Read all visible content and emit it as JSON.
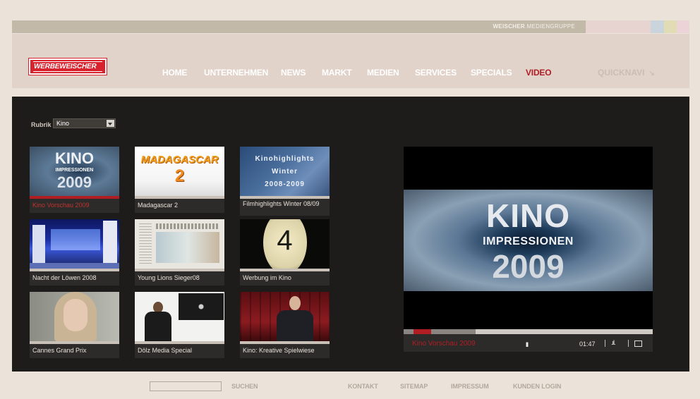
{
  "topbar": {
    "brand_bold": "WEISCHER",
    "brand_rest": ".MEDIENGRUPPE",
    "swatches": [
      "#e7d4d0",
      "#c9d4dc",
      "#e1dcb4",
      "#ecd3d8"
    ]
  },
  "header": {
    "logo_text": "WERBEWEISCHER",
    "nav": [
      {
        "label": "HOME",
        "active": false
      },
      {
        "label": "UNTERNEHMEN",
        "active": false
      },
      {
        "label": "NEWS",
        "active": false
      },
      {
        "label": "MARKT",
        "active": false
      },
      {
        "label": "MEDIEN",
        "active": false
      },
      {
        "label": "SERVICES",
        "active": false
      },
      {
        "label": "SPECIALS",
        "active": false
      },
      {
        "label": "VIDEO",
        "active": true
      }
    ],
    "quicknavi": "QUICKNAVI"
  },
  "filter": {
    "label": "Rubrik",
    "selected": "Kino"
  },
  "thumbs": [
    {
      "caption": "Kino Vorschau 2009",
      "selected": true,
      "art": "kino"
    },
    {
      "caption": "Madagascar 2",
      "selected": false,
      "art": "madagascar"
    },
    {
      "caption": "Filmhighlights Winter 08/09",
      "selected": false,
      "art": "winter"
    },
    {
      "caption": "Nacht der Löwen 2008",
      "selected": false,
      "art": "stage"
    },
    {
      "caption": "Young Lions Sieger08",
      "selected": false,
      "art": "newspaper"
    },
    {
      "caption": "Werbung im Kino",
      "selected": false,
      "art": "countdown"
    },
    {
      "caption": "Cannes Grand Prix",
      "selected": false,
      "art": "woman"
    },
    {
      "caption": "Dölz Media Special",
      "selected": false,
      "art": "speaker"
    },
    {
      "caption": "Kino: Kreative Spielwiese",
      "selected": false,
      "art": "man"
    }
  ],
  "thumb_art": {
    "kino": {
      "l1": "KINO",
      "l2": "IMPRESSIONEN",
      "l3": "2009"
    },
    "madagascar": {
      "l1": "MADAGASCAR",
      "l2": "2"
    },
    "winter": {
      "l1": "Kinohighlights",
      "l2": "Winter",
      "l3": "2008-2009"
    },
    "countdown": {
      "l1": "4"
    }
  },
  "player": {
    "title_line1": "KINO",
    "title_line2": "IMPRESSIONEN",
    "title_line3": "2009",
    "caption": "Kino Vorschau 2009",
    "pause_symbol": "II",
    "time": "01:47",
    "volume_symbol": ".ıl.",
    "buffered_fraction": 0.29,
    "played_start_fraction": 0.04,
    "played_fraction": 0.07
  },
  "footer": {
    "search_label": "SUCHEN",
    "links": [
      "KONTAKT",
      "SITEMAP",
      "IMPRESSUM",
      "KUNDEN LOGIN"
    ]
  }
}
